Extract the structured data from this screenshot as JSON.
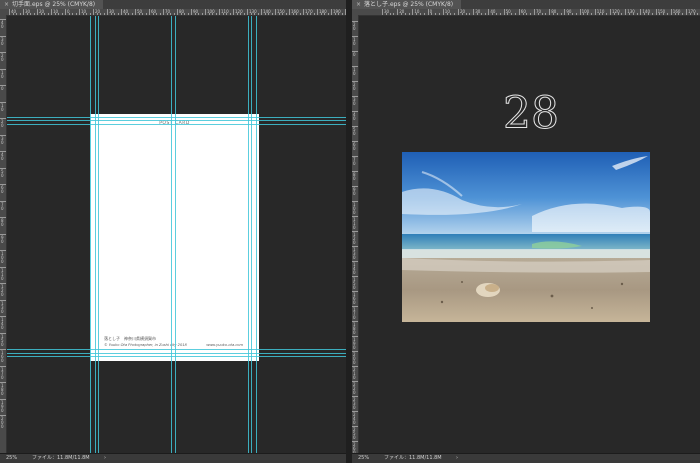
{
  "left_doc": {
    "tab_title": "切手面.eps @ 25% (CMYK/8)",
    "card": {
      "title": "POST CARD",
      "line1": "落とし子　神奈川県横須賀市",
      "line2": "© Yuuko Ota Photographer, in Zushi city 2018",
      "url": "www.yuuko-ota.com"
    },
    "status": {
      "zoom": "25%",
      "file_label": "ファイル：11.8M/11.8M",
      "arrow": "›"
    },
    "ruler_h": [
      "40",
      "30",
      "20",
      "10",
      "0",
      "10",
      "20",
      "30",
      "40",
      "50",
      "60",
      "70",
      "80",
      "90",
      "100",
      "110",
      "120",
      "130",
      "140",
      "150",
      "160",
      "170",
      "180",
      "190",
      "200"
    ]
  },
  "right_doc": {
    "tab_title": "落とし子.eps @ 25% (CMYK/8)",
    "page_number": "28",
    "status": {
      "zoom": "25%",
      "file_label": "ファイル：11.8M/11.8M",
      "arrow": "›"
    },
    "ruler_h": [
      "30",
      "20",
      "10",
      "0",
      "10",
      "20",
      "30",
      "40",
      "50",
      "60",
      "70",
      "80",
      "90",
      "100",
      "110",
      "120",
      "130",
      "140",
      "150",
      "160",
      "170"
    ],
    "ruler_v": [
      "20",
      "10",
      "0",
      "10",
      "20",
      "30",
      "40",
      "50",
      "60",
      "70",
      "80",
      "90",
      "100",
      "110",
      "120",
      "130",
      "140",
      "150",
      "160",
      "170",
      "180",
      "190",
      "200",
      "210",
      "220",
      "230",
      "240",
      "250",
      "260",
      "270"
    ]
  },
  "icons": {
    "close": "close-icon"
  },
  "colors": {
    "guide": "#3fc6d8",
    "bg": "#282828",
    "tab": "#535353"
  }
}
